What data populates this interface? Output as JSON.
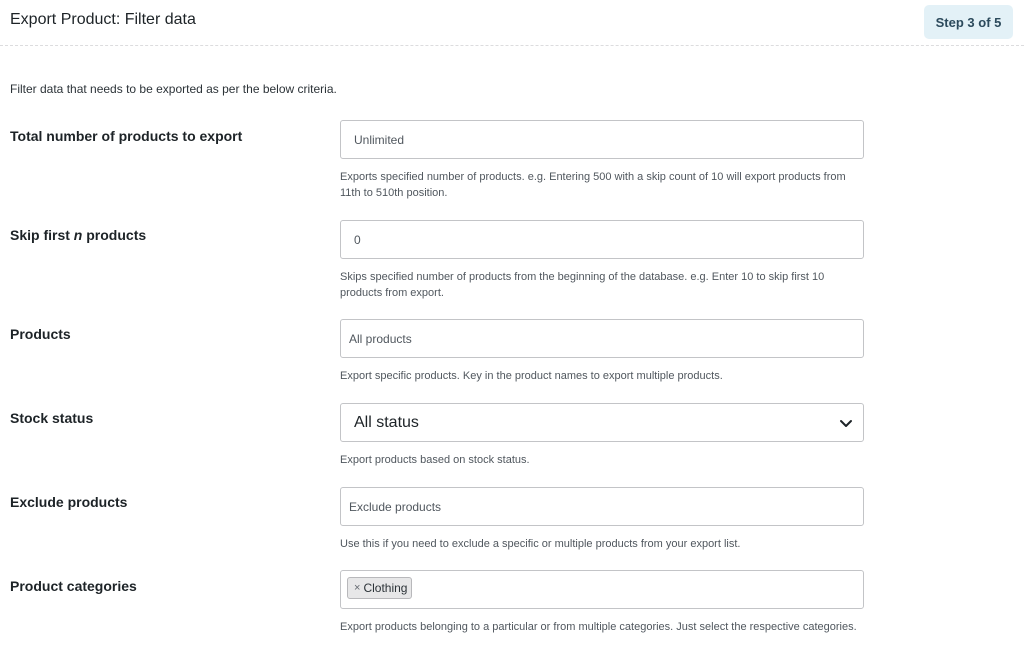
{
  "header": {
    "title": "Export Product: Filter data",
    "step": "Step 3 of 5"
  },
  "intro": "Filter data that needs to be exported as per the below criteria.",
  "fields": {
    "total": {
      "label": "Total number of products to export",
      "placeholder": "Unlimited",
      "value": "",
      "help": "Exports specified number of products. e.g. Entering 500 with a skip count of 10 will export products from 11th to 510th position."
    },
    "skip": {
      "label_prefix": "Skip first",
      "label_var": "n",
      "label_suffix": "products",
      "placeholder": "0",
      "value": "",
      "help": "Skips specified number of products from the beginning of the database. e.g. Enter 10 to skip first 10 products from export."
    },
    "products": {
      "label": "Products",
      "placeholder": "All products",
      "help": "Export specific products. Key in the product names to export multiple products."
    },
    "stock": {
      "label": "Stock status",
      "selected": "All status",
      "help": "Export products based on stock status."
    },
    "exclude": {
      "label": "Exclude products",
      "placeholder": "Exclude products",
      "help": "Use this if you need to exclude a specific or multiple products from your export list."
    },
    "categories": {
      "label": "Product categories",
      "tags": [
        {
          "remove": "×",
          "label": "Clothing"
        }
      ],
      "help": "Export products belonging to a particular or from multiple categories. Just select the respective categories."
    }
  },
  "icons": {
    "select_arrow": "chevron-down-icon",
    "tag_remove": "close-icon"
  },
  "colors": {
    "badge_bg": "#e3f1f7",
    "badge_text": "#2c4a5c",
    "border": "#c3c4c7"
  }
}
